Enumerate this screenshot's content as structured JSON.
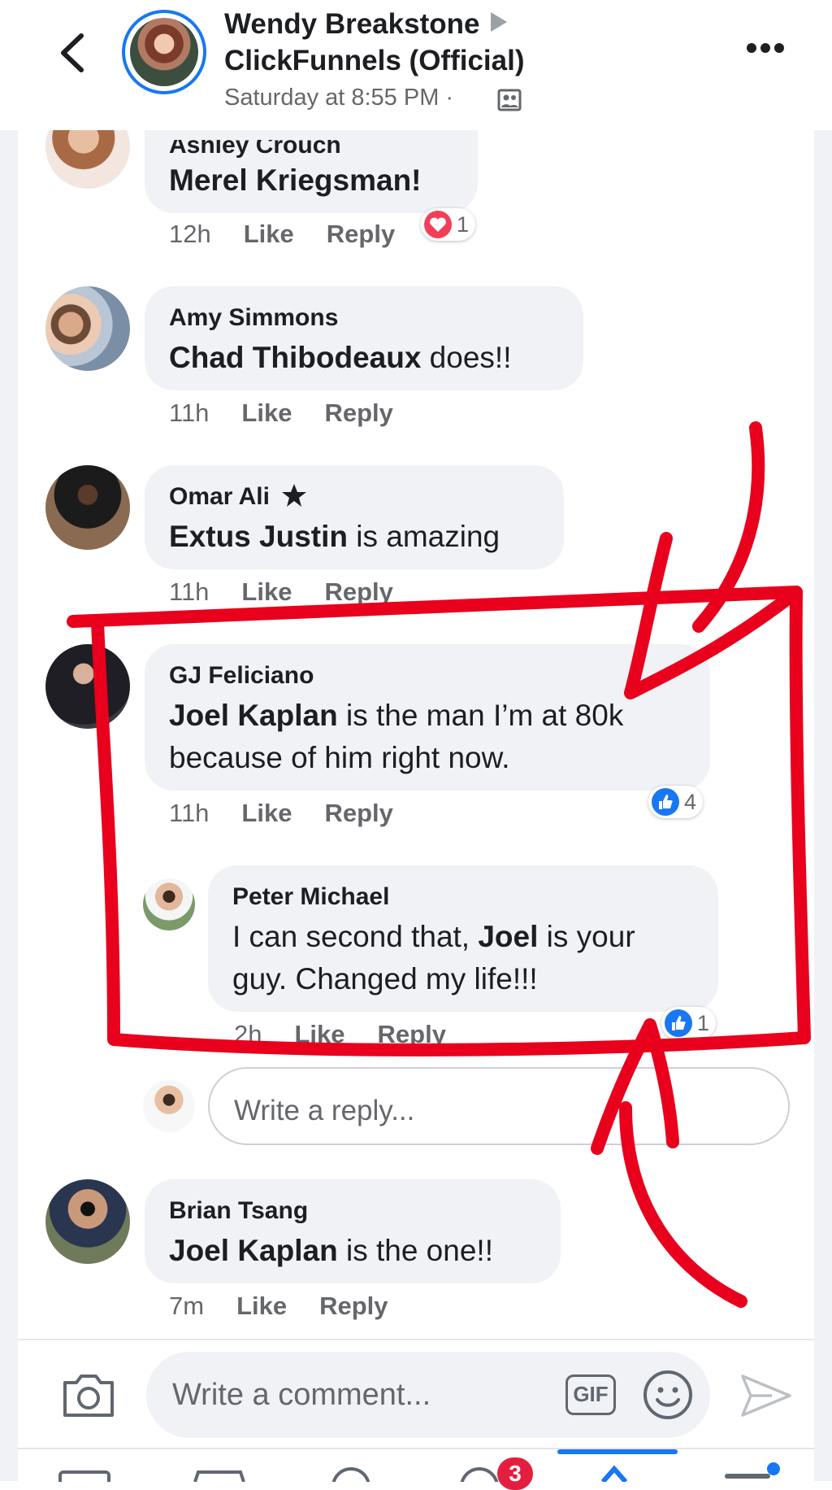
{
  "header": {
    "author": "Wendy Breakstone",
    "group": "ClickFunnels (Official)",
    "timestamp": "Saturday at 8:55 PM ·",
    "back_icon": "chevron-left-icon",
    "privacy_icon": "group-members-icon",
    "more_icon": "more-horizontal-icon"
  },
  "comments": [
    {
      "name": "Ashley Crouch",
      "text_bold": "Merel Kriegsman!",
      "text_rest": "",
      "time": "12h",
      "like": "Like",
      "reply": "Reply",
      "reaction_count": "1",
      "reaction_type": "love"
    },
    {
      "name": "Amy Simmons",
      "text_bold": "Chad Thibodeaux",
      "text_rest": " does!!",
      "time": "11h",
      "like": "Like",
      "reply": "Reply"
    },
    {
      "name": "Omar Ali",
      "text_bold": "Extus Justin",
      "text_rest": " is amazing",
      "time": "11h",
      "like": "Like",
      "reply": "Reply",
      "badge_icon": "top-fan-star-icon"
    },
    {
      "name": "GJ Feliciano",
      "line1_bold": "Joel Kaplan",
      "line1_rest": " is the man I’m at 80k",
      "line2": "because of him right now.",
      "time": "11h",
      "like": "Like",
      "reply": "Reply",
      "reaction_count": "4",
      "reaction_type": "like"
    },
    {
      "name": "Brian Tsang",
      "text_bold": "Joel Kaplan",
      "text_rest": " is the one!!",
      "time": "7m",
      "like": "Like",
      "reply": "Reply"
    }
  ],
  "reply": {
    "name": "Peter Michael",
    "line1_pre": "I can second that, ",
    "line1_bold": "Joel",
    "line1_post": " is your",
    "line2": "guy. Changed my life!!!",
    "time": "2h",
    "like": "Like",
    "reply": "Reply",
    "reaction_count": "1",
    "reaction_type": "like"
  },
  "reply_input": {
    "placeholder": "Write a reply..."
  },
  "composer": {
    "placeholder": "Write a comment...",
    "gif_label": "GIF",
    "camera_icon": "camera-icon",
    "emoji_icon": "emoji-icon",
    "send_icon": "send-icon"
  },
  "tabbar": {
    "notification_badge": "3"
  },
  "colors": {
    "accent": "#1877f2",
    "annotation_red": "#e8001c",
    "bubble": "#f0f2f5",
    "love": "#f33e58"
  }
}
